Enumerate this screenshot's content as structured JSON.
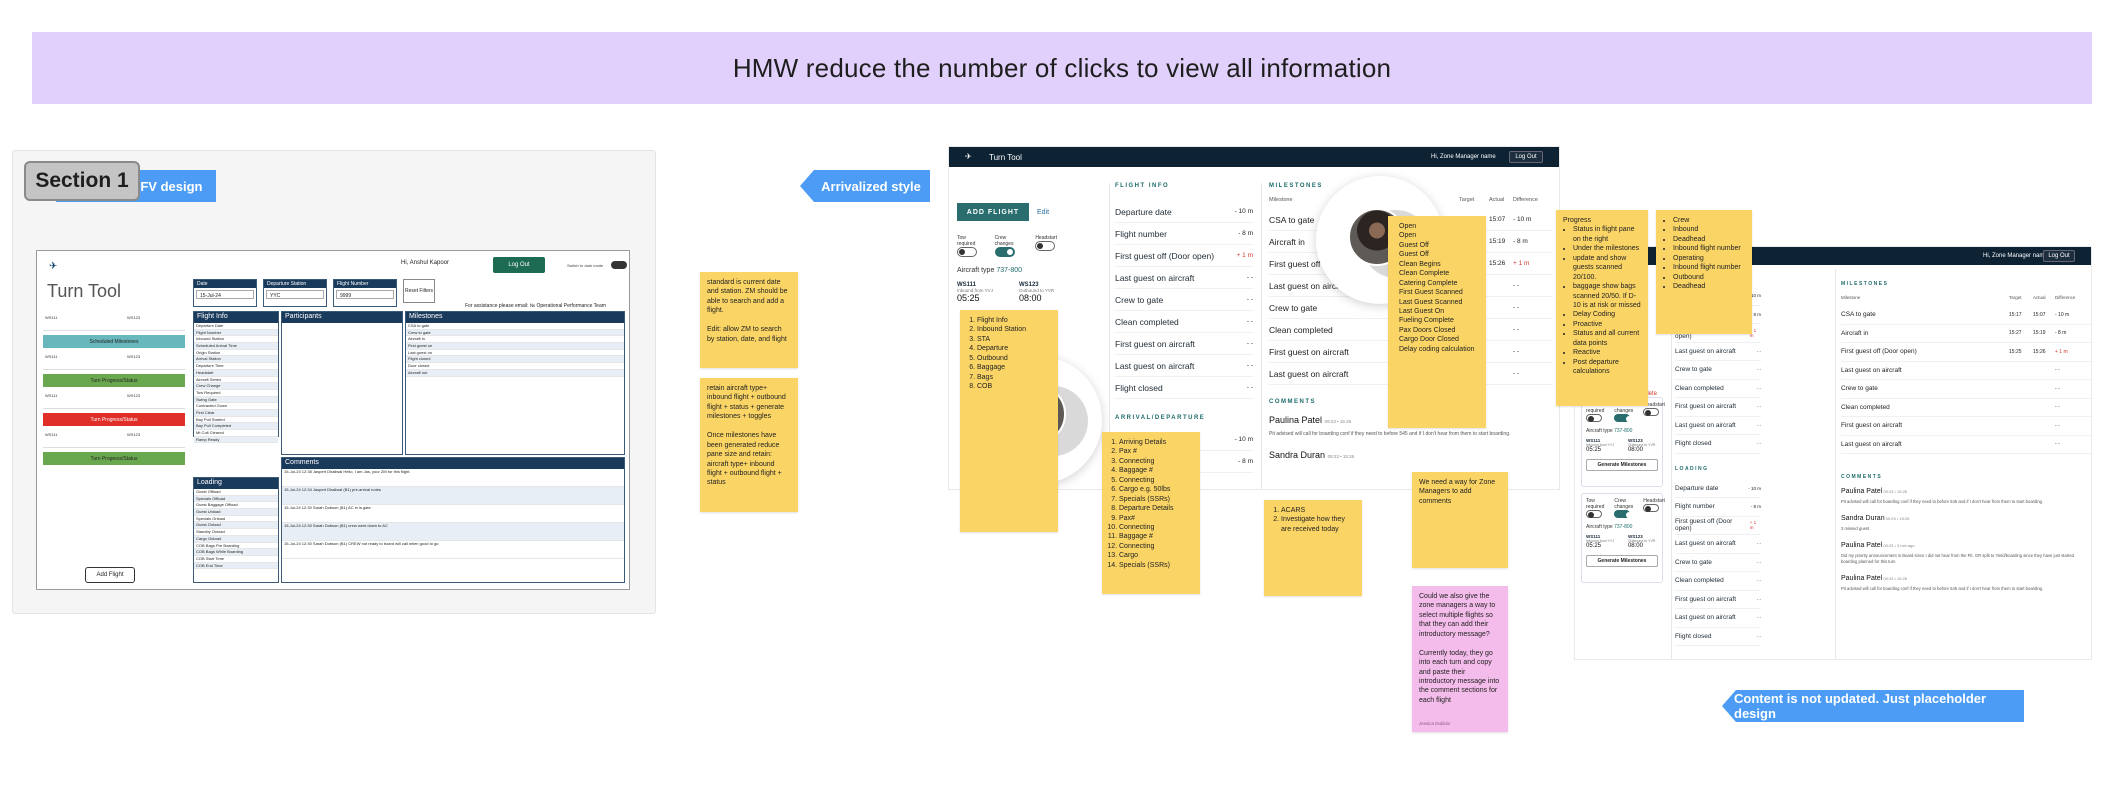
{
  "banner": {
    "title": "HMW reduce the number of clicks to view all information"
  },
  "section": {
    "label": "Section 1"
  },
  "labels": {
    "mfv": "MFV design",
    "arrivalized": "Arrivalized style",
    "placeholder": "Content is not updated. Just placeholder design"
  },
  "mfv_screen": {
    "greeting": "Hi, Anshul Kapoor",
    "logout": "Log Out",
    "switch_label": "Switch to dark mode",
    "title": "Turn Tool",
    "filters": [
      {
        "label": "Date",
        "value": "15-Jul-24"
      },
      {
        "label": "Departure Station",
        "value": "YYC"
      },
      {
        "label": "Flight Number",
        "value": "9999"
      }
    ],
    "reset": "Reset Filters",
    "assistance": "For assistance please email: № Operational Performance Team",
    "bars": [
      "Scheduled Milestones",
      "Turn Progress/Status",
      "Turn Progress/Status",
      "Turn Progress/Status"
    ],
    "add_flight": "Add Flight",
    "panels": {
      "flight_info": "Flight Info",
      "participants": "Participants",
      "milestones": "Milestones",
      "comments": "Comments",
      "loading": "Loading"
    },
    "flight_info_rows": [
      "Departure Date",
      "Flight Number",
      "Inbound Station",
      "Scheduled Arrival Time",
      "Origin Station",
      "Arrival Station",
      "Departure Time",
      "Headstart",
      "Aircraft Series",
      "Crew Change",
      "Tow Required",
      "Swing Gate",
      "Contracted Gown",
      "First Clear",
      "Bay Pull Started",
      "Bay Pull Completed",
      "Mt Colt Cleared",
      "Ramp Ready"
    ],
    "milestone_rows": [
      "CSA to gate",
      "Crew to gate",
      "Aircraft in",
      "First guest on",
      "Last guest on",
      "Flight closed",
      "Door closed",
      "Aircraft out"
    ],
    "loading_rows": [
      "Guest Offload",
      "Specials Offload",
      "Guest Baggage Offload",
      "Guest Unload",
      "Specials Onload",
      "Guest Onload",
      "Standby Onload",
      "Cargo Onload",
      "COB Bags Pre Boarding",
      "COB Bags While Boarding",
      "COB Start Time",
      "COB End Time"
    ],
    "comment_rows": [
      "15-Jul-24 12:38  Jaspert Dhaliwal  Hello, I am Jas, your ZM for this flight.",
      "15-Jul-24 12:34  Jaspert Dhaliwal  (B1) pre-arrival notes",
      "15-Jul-24 12:30  Sarah Dobson  (B1) AC in is gate",
      "15-Jul-24 12:30  Sarah Dobson  (B1) crew went down to AC",
      "15-Jul-24 12:30  Sarah Dobson  (B1) CREW not ready to board will call when good to go"
    ]
  },
  "stickies": {
    "s1": "standard is current date and station. ZM should be able to search and add a flight.\n\nEdit: allow ZM to search by station, date, and flight",
    "s2": "retain aircraft type+ inbound flight + outbound flight + status + generate milestones + toggles\n\nOnce milestones have been generated reduce pane size and retain: aircraft type+ inbound flight + outbound flight + status",
    "s3_items": [
      "Flight Info",
      "Inbound Station",
      "STA",
      "Departure",
      "Outbound",
      "Baggage",
      "Bags",
      "COB"
    ],
    "s4_items": [
      "Arriving Details",
      "Pax #",
      "Connecting",
      "Baggage #",
      "Connecting",
      "Cargo e.g. 50lbs",
      "Specials (SSRs)",
      "Departure Details",
      "Pax#",
      "Connecting",
      "Baggage #",
      "Connecting",
      "Cargo",
      "Specials (SSRs)"
    ],
    "s5_items": [
      "ACARS",
      "Investigate how they are received today"
    ],
    "s6_items": [
      "Open",
      "Open",
      "Guest Off",
      "Guest Off",
      "Clean Begins",
      "Clean Complete",
      "Catering Complete",
      "First Guest Scanned",
      "Last Guest Scanned",
      "Last Guest On",
      "Fueling Complete",
      "Pax Doors Closed",
      "Cargo Door Closed",
      "Delay coding calculation"
    ],
    "s7_title": "Progress",
    "s7_items": [
      "Status in flight pane on the right",
      "Under the milestones",
      "update and show guests scanned 20/100.",
      "baggage show bags scanned 20/50. If D-10 is at risk or missed",
      "Delay Coding",
      "Proactive",
      "Status and all current data points",
      "Reactive",
      "Post departure calculations"
    ],
    "s8_items": [
      "Crew",
      "Inbound",
      "Deadhead",
      "Inbound flight number",
      "Operating",
      "Inbound flight number",
      "Outbound",
      "Deadhead"
    ],
    "s9": "We need a way for Zone Managers to add comments",
    "s10": "Could we also give the zone managers a way to select multiple flights so that they can add their introductory message?\n\nCurrently today, they go into each turn and copy and paste their introductory message into the comment sections for each flight",
    "s10_author": "Jessica Dubloix"
  },
  "mock_a": {
    "brand": "Turn Tool",
    "user": "Hi, Zone Manager name",
    "logout": "Log Out",
    "add_flight": "ADD FLIGHT",
    "edit": "Edit",
    "toggles": [
      "Tow required",
      "Crew changes",
      "Headstart"
    ],
    "aircraft_type": "Aircraft type",
    "aircraft_code": "737-800",
    "inbound": {
      "flight": "WS111",
      "sub": "Inbound from YVJ",
      "time": "05:25"
    },
    "outbound": {
      "flight": "WS123",
      "sub": "Outbound to YVR",
      "time": "08:00"
    },
    "flight_info_caption": "FLIGHT INFO",
    "flight_info": [
      {
        "label": "Departure date",
        "val": "- 10 m",
        "red": false
      },
      {
        "label": "Flight number",
        "val": "- 8 m",
        "red": false
      },
      {
        "label": "First guest off (Door open)",
        "val": "+ 1 m",
        "red": true
      },
      {
        "label": "Last guest on aircraft",
        "val": "- -",
        "red": false
      },
      {
        "label": "Crew to gate",
        "val": "- -",
        "red": false
      },
      {
        "label": "Clean completed",
        "val": "- -",
        "red": false
      },
      {
        "label": "First guest on aircraft",
        "val": "- -",
        "red": false
      },
      {
        "label": "Last guest on aircraft",
        "val": "- -",
        "red": false
      },
      {
        "label": "Flight closed",
        "val": "- -",
        "red": false
      }
    ],
    "arrival_caption": "ARRIVAL/DEPARTURE",
    "arrival": [
      {
        "label": "Departure date",
        "val": "- 10 m"
      },
      {
        "label": "",
        "val": "- 8 m"
      }
    ],
    "milestones_caption": "MILESTONES",
    "ms_head": [
      "Milestone",
      "Target",
      "Actual",
      "Difference"
    ],
    "milestones": [
      {
        "label": "CSA to gate",
        "target": "15:17",
        "actual": "15:07",
        "diff": "- 10 m",
        "red": false
      },
      {
        "label": "Aircraft in",
        "target": "15:27",
        "actual": "15:19",
        "diff": "- 8 m",
        "red": false
      },
      {
        "label": "First guest off (Door open)",
        "target": "15:25",
        "actual": "15:26",
        "diff": "+ 1 m",
        "red": true
      },
      {
        "label": "Last guest on aircraft",
        "target": "",
        "actual": "",
        "diff": "- -",
        "red": false
      },
      {
        "label": "Crew to gate",
        "target": "",
        "actual": "",
        "diff": "- -",
        "red": false
      },
      {
        "label": "Clean completed",
        "target": "",
        "actual": "",
        "diff": "- -",
        "red": false
      },
      {
        "label": "First guest on aircraft",
        "target": "",
        "actual": "",
        "diff": "- -",
        "red": false
      },
      {
        "label": "Last guest on aircraft",
        "target": "",
        "actual": "",
        "diff": "- -",
        "red": false
      }
    ],
    "comments_caption": "COMMENTS",
    "comment1_name": "Paulina Patel",
    "comment1_time": "09:23 • 15:26",
    "comment1_text": "Pit advised will call for boarding conf if they need to before 545 and if I don't hear from them to start boarding.",
    "comment2_name": "Sandra Duran",
    "comment2_time": "09:23 • 15:26"
  },
  "mock_b": {
    "user": "Hi, Zone Manager name",
    "logout": "Log Out",
    "milestones_caption": "MILESTONES",
    "ms_head": [
      "Milestone",
      "Target",
      "Actual",
      "Difference"
    ],
    "milestones": [
      {
        "label": "CSA to gate",
        "target": "15:17",
        "actual": "15:07",
        "diff": "- 10 m",
        "red": false
      },
      {
        "label": "Aircraft in",
        "target": "15:27",
        "actual": "15:19",
        "diff": "- 8 m",
        "red": false
      },
      {
        "label": "First guest off (Door open)",
        "target": "15:25",
        "actual": "15:26",
        "diff": "+ 1 m",
        "red": true
      },
      {
        "label": "Last guest on aircraft",
        "target": "",
        "actual": "",
        "diff": "- -",
        "red": false
      },
      {
        "label": "Crew to gate",
        "target": "",
        "actual": "",
        "diff": "- -",
        "red": false
      },
      {
        "label": "Clean completed",
        "target": "",
        "actual": "",
        "diff": "- -",
        "red": false
      },
      {
        "label": "First guest on aircraft",
        "target": "",
        "actual": "",
        "diff": "- -",
        "red": false
      },
      {
        "label": "Last guest on aircraft",
        "target": "",
        "actual": "",
        "diff": "- -",
        "red": false
      }
    ],
    "info_rows": [
      {
        "label": "",
        "val": "- 10 m",
        "red": false
      },
      {
        "label": "",
        "val": "- 8 m",
        "red": false
      },
      {
        "label": "First guest off (Door open)",
        "val": "+ 1 m",
        "red": true
      },
      {
        "label": "Last guest on aircraft",
        "val": "- -",
        "red": false
      },
      {
        "label": "Crew to gate",
        "val": "- -",
        "red": false
      },
      {
        "label": "Clean completed",
        "val": "- -",
        "red": false
      },
      {
        "label": "First guest on aircraft",
        "val": "- -",
        "red": false
      },
      {
        "label": "Last guest on aircraft",
        "val": "- -",
        "red": false
      },
      {
        "label": "Flight closed",
        "val": "- -",
        "red": false
      }
    ],
    "loading_caption": "LOADING",
    "loading_rows": [
      {
        "label": "Departure date",
        "val": "- 10 m",
        "red": false
      },
      {
        "label": "Flight number",
        "val": "- 8 m",
        "red": false
      },
      {
        "label": "First guest off (Door open)",
        "val": "+ 1 m",
        "red": true
      },
      {
        "label": "Last guest on aircraft",
        "val": "- -",
        "red": false
      },
      {
        "label": "Crew to gate",
        "val": "- -",
        "red": false
      },
      {
        "label": "Clean completed",
        "val": "- -",
        "red": false
      },
      {
        "label": "First guest on aircraft",
        "val": "- -",
        "red": false
      },
      {
        "label": "Last guest on aircraft",
        "val": "- -",
        "red": false
      },
      {
        "label": "Flight closed",
        "val": "- -",
        "red": false
      }
    ],
    "comments_caption": "COMMENTS",
    "comments": [
      {
        "name": "Paulina Patel",
        "time": "09:23 • 15:26",
        "text": "Pit advised will call for boarding conf if they need to before 545 and if I don't hear from them to start boarding."
      },
      {
        "name": "Sandra Duran",
        "time": "09:23 • 15:26",
        "text": "3 missed guest"
      },
      {
        "name": "Paulina Patel",
        "time": "09:23 • 3 min ago",
        "text": "Did my priority announcement in Board since I did not hear from the Pit. GR split to Yield/boarding since they have just started boarding planned for this turn"
      },
      {
        "name": "Paulina Patel",
        "time": "09:23 • 15:26",
        "text": "Pit advised will call for boarding conf if they need to before 545 and if I don't hear from them to start boarding."
      }
    ],
    "cards": [
      {
        "toggles": [
          "Tow required",
          "Crew changes",
          "Headstart"
        ],
        "aircraft": "Aircraft type",
        "code": "737-800",
        "in_flight": "WS111",
        "in_sub": "Inbound from YYJ",
        "in_time": "05:25",
        "out_flight": "WS123",
        "out_sub": "Outbound to YVR",
        "out_time": "08:00",
        "button": "Generate Milestones"
      },
      {
        "toggles": [
          "Tow required",
          "Crew changes",
          "Headstart"
        ],
        "aircraft": "Aircraft type",
        "code": "737-800",
        "in_flight": "WS111",
        "in_sub": "Inbound from YYJ",
        "in_time": "05:25",
        "out_flight": "WS123",
        "out_sub": "Outbound to YVR",
        "out_time": "08:00",
        "button": "Generate Milestones"
      }
    ],
    "partial_text": "mplete"
  }
}
